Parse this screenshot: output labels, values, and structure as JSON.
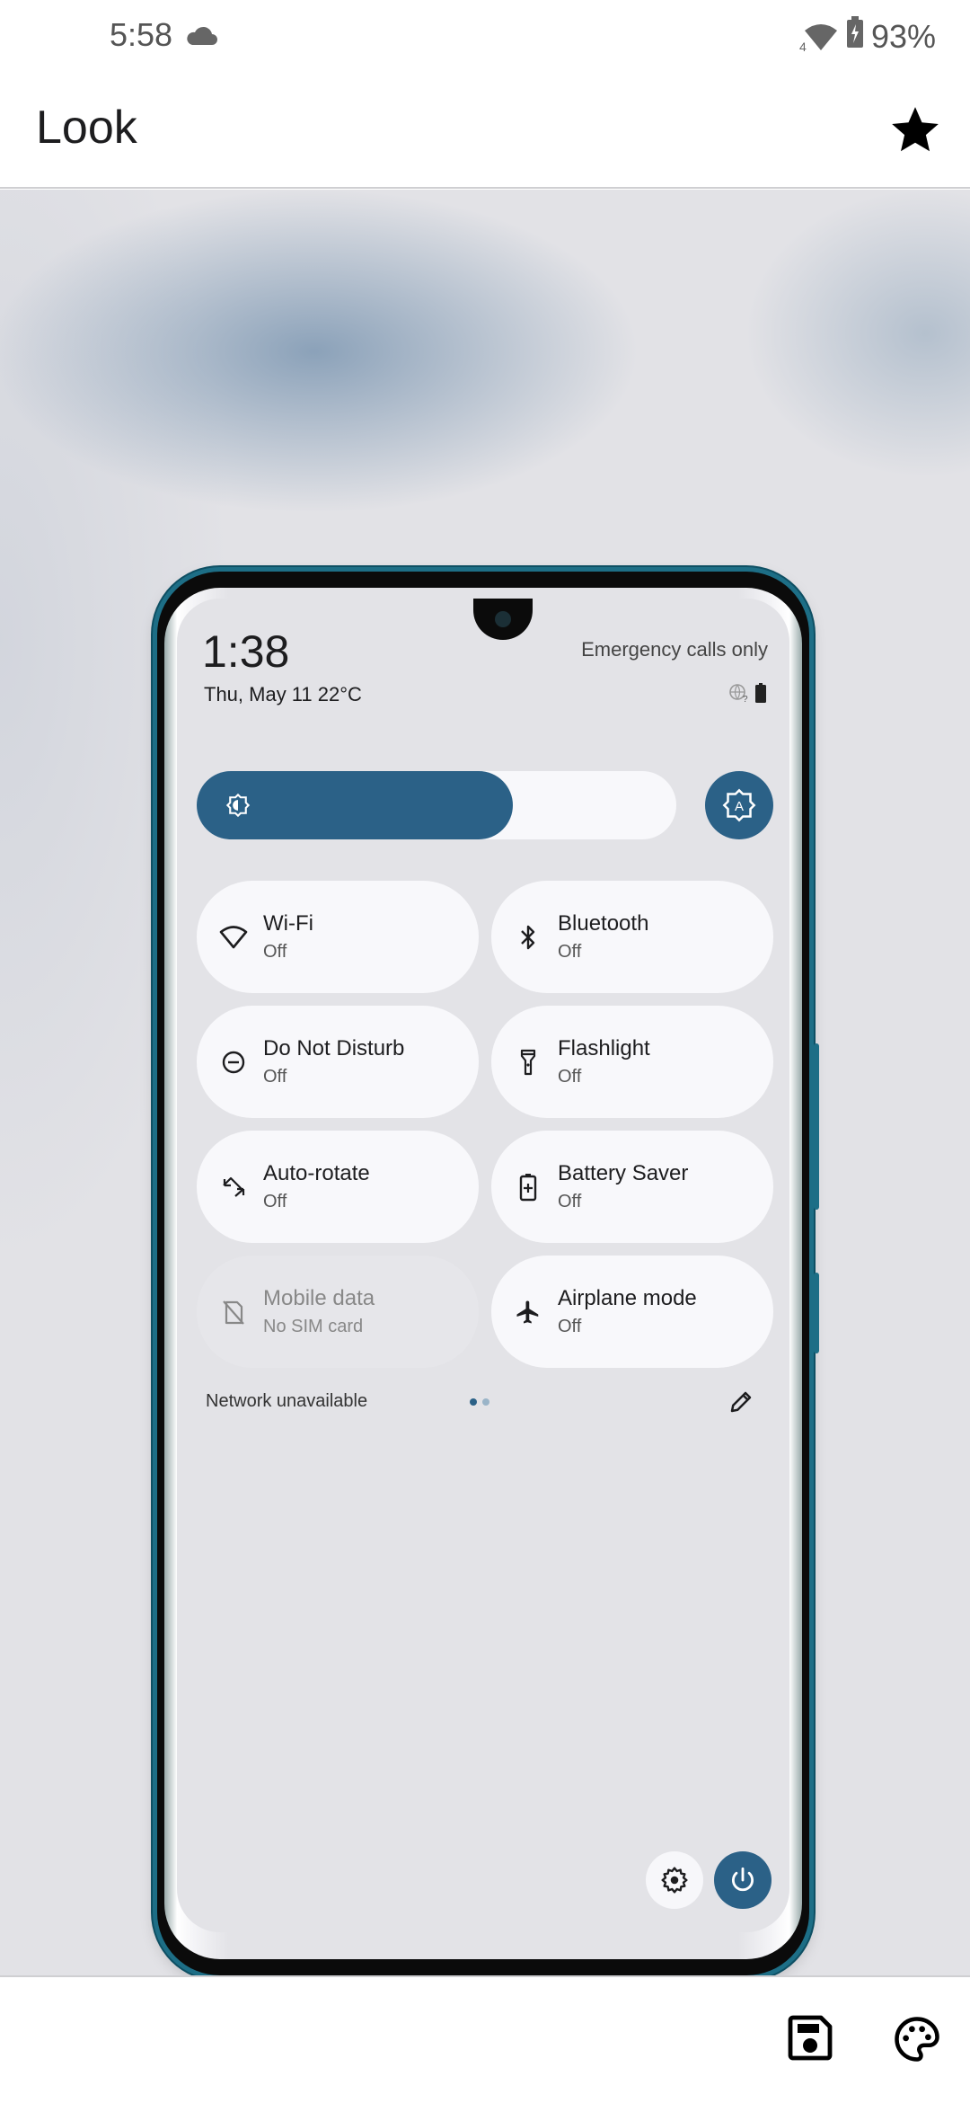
{
  "status_bar": {
    "time": "5:58",
    "weather_icon": "cloud-icon",
    "network_icons": [
      "wifi-icon",
      "battery-charging-icon"
    ],
    "wifi_badge": "4",
    "battery_percent": "93%"
  },
  "app_bar": {
    "title": "Look",
    "action_icon": "star-icon"
  },
  "preview": {
    "lock_time": "1:38",
    "date_weather": "Thu, May 11 22°C",
    "carrier_text": "Emergency calls only",
    "mini_icons": [
      "globe-question-icon",
      "battery-icon"
    ],
    "brightness": {
      "level_fraction": 0.66,
      "icon": "brightness-icon"
    },
    "auto_brightness_icon": "auto-brightness-icon",
    "accent_color": "#2b6187",
    "tiles": [
      {
        "label": "Wi-Fi",
        "state": "Off",
        "icon": "wifi-icon",
        "enabled": true
      },
      {
        "label": "Bluetooth",
        "state": "Off",
        "icon": "bluetooth-icon",
        "enabled": true
      },
      {
        "label": "Do Not Disturb",
        "state": "Off",
        "icon": "do-not-disturb-icon",
        "enabled": true
      },
      {
        "label": "Flashlight",
        "state": "Off",
        "icon": "flashlight-icon",
        "enabled": true
      },
      {
        "label": "Auto-rotate",
        "state": "Off",
        "icon": "auto-rotate-icon",
        "enabled": true
      },
      {
        "label": "Battery Saver",
        "state": "Off",
        "icon": "battery-saver-icon",
        "enabled": true
      },
      {
        "label": "Mobile data",
        "state": "No SIM card",
        "icon": "no-sim-icon",
        "enabled": false
      },
      {
        "label": "Airplane mode",
        "state": "Off",
        "icon": "airplane-icon",
        "enabled": true
      }
    ],
    "footer": {
      "network_text": "Network unavailable",
      "page_count": 2,
      "current_page": 1,
      "edit_icon": "pencil-icon"
    },
    "bottom_buttons": [
      "settings-icon",
      "power-icon"
    ]
  },
  "bottom_bar": {
    "actions": [
      "save-icon",
      "palette-icon"
    ]
  }
}
